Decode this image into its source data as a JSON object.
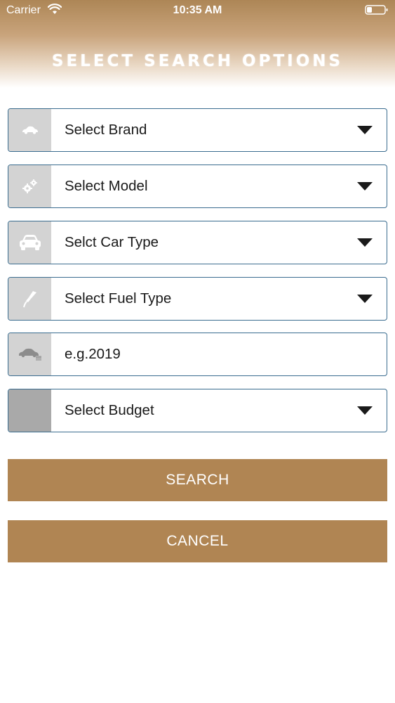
{
  "status_bar": {
    "carrier": "Carrier",
    "time": "10:35 AM"
  },
  "header": {
    "title": "SELECT SEARCH OPTIONS"
  },
  "form": {
    "brand": {
      "label": "Select Brand",
      "icon": "car-silhouette-icon"
    },
    "model": {
      "label": "Select Model",
      "icon": "gears-icon"
    },
    "car_type": {
      "label": "Selct Car Type",
      "icon": "car-front-icon"
    },
    "fuel_type": {
      "label": "Select Fuel Type",
      "icon": "fuel-nozzle-icon"
    },
    "year": {
      "placeholder": "e.g.2019",
      "icon": "car-calendar-icon"
    },
    "budget": {
      "label": "Select Budget",
      "icon": ""
    }
  },
  "buttons": {
    "search": "SEARCH",
    "cancel": "CANCEL"
  },
  "colors": {
    "accent": "#b08553",
    "field_border": "#3a6c8f",
    "icon_box": "#d3d3d3",
    "icon_box_budget": "#a9a9a9"
  }
}
